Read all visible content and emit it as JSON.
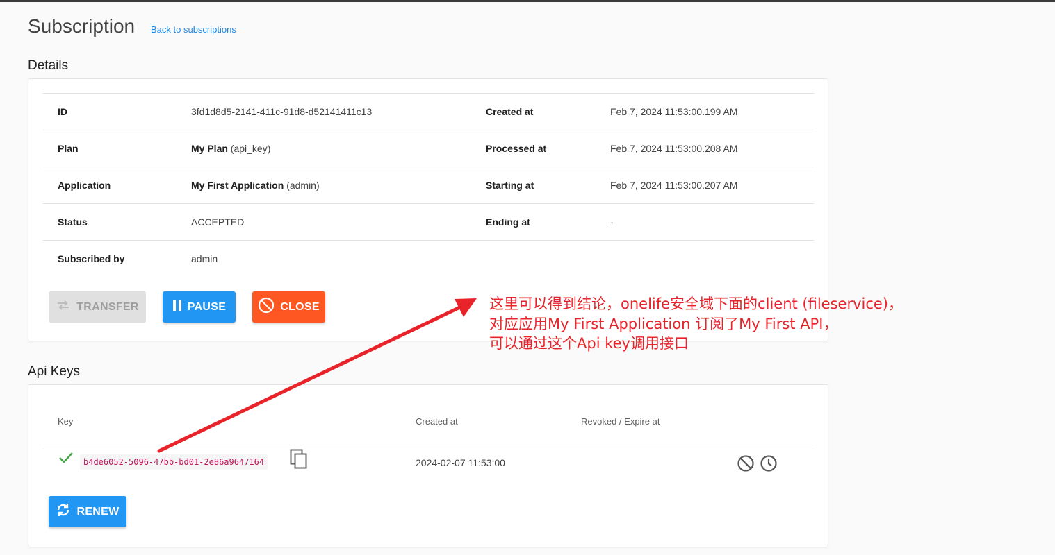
{
  "page": {
    "title": "Subscription",
    "back_link": "Back to subscriptions"
  },
  "details": {
    "title": "Details",
    "rows": [
      {
        "label": "ID",
        "value": "3fd1d8d5-2141-411c-91d8-d52141411c13",
        "label2": "Created at",
        "value2": "Feb 7, 2024 11:53:00.199 AM"
      },
      {
        "label": "Plan",
        "value_bold": "My Plan",
        "value_extra": " (api_key)",
        "label2": "Processed at",
        "value2": "Feb 7, 2024 11:53:00.208 AM"
      },
      {
        "label": "Application",
        "value_bold": "My First Application",
        "value_extra": " (admin)",
        "label2": "Starting at",
        "value2": "Feb 7, 2024 11:53:00.207 AM"
      },
      {
        "label": "Status",
        "value": "ACCEPTED",
        "label2": "Ending at",
        "value2": "-"
      },
      {
        "label": "Subscribed by",
        "value": "admin"
      }
    ],
    "buttons": {
      "transfer": "TRANSFER",
      "pause": "PAUSE",
      "close": "CLOSE"
    }
  },
  "api_keys": {
    "title": "Api Keys",
    "headers": {
      "key": "Key",
      "created": "Created at",
      "revoked": "Revoked / Expire at"
    },
    "rows": [
      {
        "key": "b4de6052-5096-47bb-bd01-2e86a9647164",
        "created": "2024-02-07 11:53:00",
        "revoked": ""
      }
    ],
    "renew_label": "RENEW"
  },
  "annotation": {
    "line1": "这里可以得到结论，onelife安全域下面的client (fileservice)，",
    "line2": "对应应用My First Application 订阅了My First API，",
    "line3": "可以通过这个Api key调用接口"
  },
  "colors": {
    "primary": "#2196f3",
    "danger": "#ff5722",
    "disabled": "#e0e0e0",
    "annotation": "#e8232a",
    "valid": "#43a047",
    "key_text": "#c2185b"
  }
}
